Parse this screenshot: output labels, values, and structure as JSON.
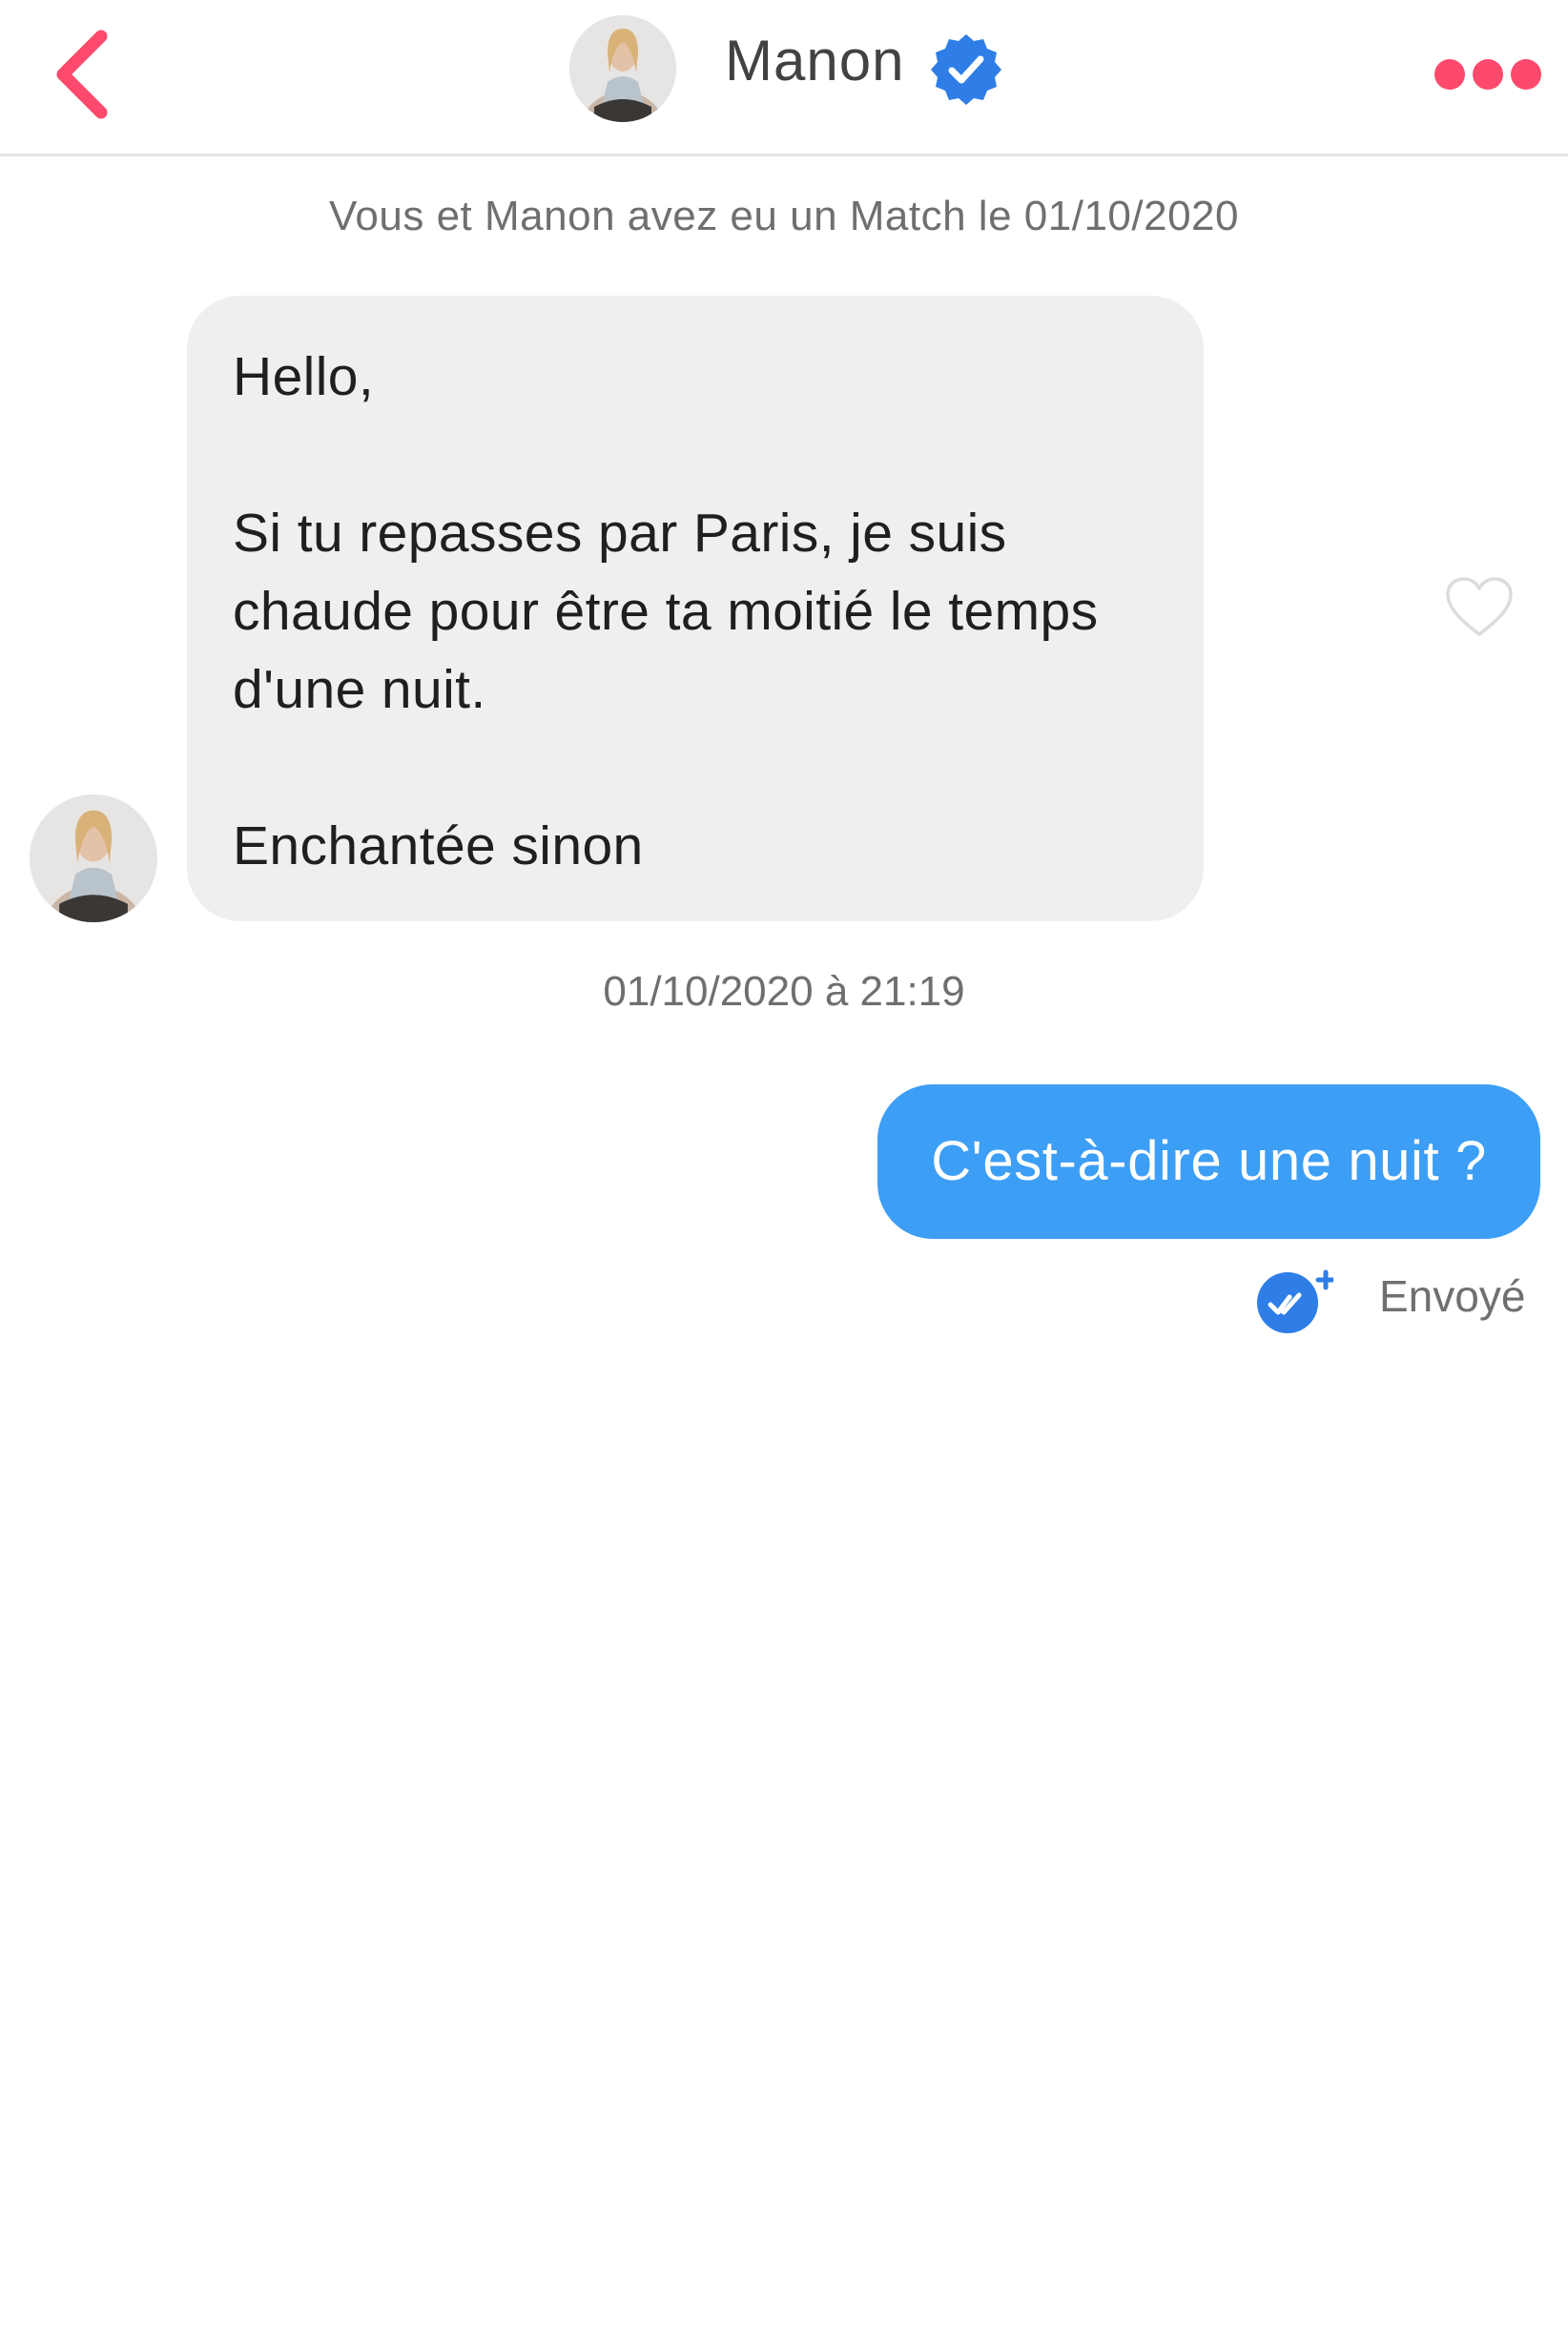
{
  "header": {
    "name": "Manon",
    "back_icon": "chevron-left-icon",
    "verified_icon": "verified-badge-icon",
    "more_icon": "more-dots-icon",
    "accent_color": "#fd4a6c",
    "verified_color": "#2f7ee8"
  },
  "match_banner": "Vous et Manon avez eu un Match le 01/10/2020",
  "messages": [
    {
      "direction": "incoming",
      "text": "Hello,\n\nSi tu repasses par Paris, je suis chaude pour être ta moitié le temps d'une nuit.\n\nEnchantée sinon",
      "like_icon": "heart-outline-icon",
      "timestamp": "01/10/2020 à 21:19"
    },
    {
      "direction": "outgoing",
      "text": "C'est-à-dire une nuit ?",
      "status": "Envoyé",
      "status_icon": "double-check-icon",
      "bubble_color": "#3d9ef5"
    }
  ]
}
